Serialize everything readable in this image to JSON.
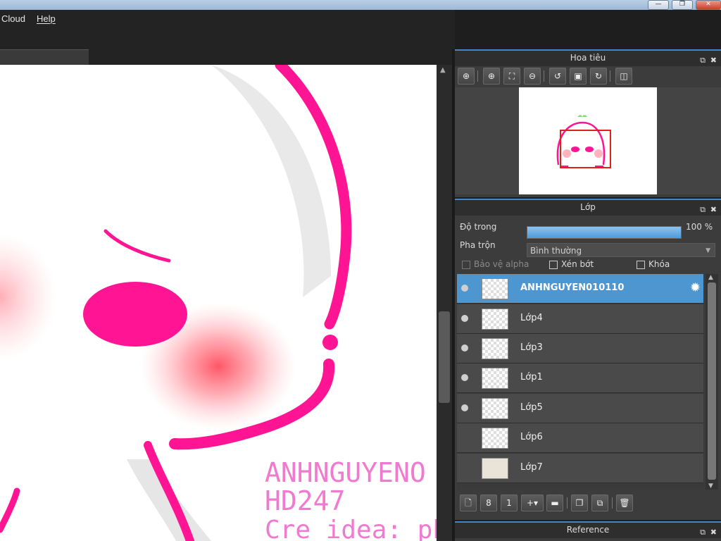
{
  "menu": {
    "items": [
      {
        "label": "Cloud",
        "accel": "o"
      },
      {
        "label": "Help",
        "accel": "H"
      }
    ]
  },
  "window_controls": {
    "minimize": "—",
    "restore": "❐",
    "close": "✕"
  },
  "canvas": {
    "watermark_lines": [
      "ANHNGUYENO",
      "HD247",
      "Cre idea: phuc"
    ],
    "colors": {
      "line": "#ff1493",
      "blush": "#ff5a6e",
      "shadow": "#e8e8e8",
      "watermark": "#f07ad0"
    }
  },
  "navigator": {
    "title": "Hoa tiêu",
    "tools": [
      "zoom-in-icon",
      "zoom-in-2-icon",
      "fit-icon",
      "zoom-out-icon",
      "rotate-left-icon",
      "actual-size-icon",
      "rotate-right-icon",
      "flip-icon"
    ]
  },
  "layers": {
    "title": "Lớp",
    "opacity_label": "Độ trong",
    "opacity_value": "100 %",
    "opacity_fraction": 1.0,
    "blend_label": "Pha trộn",
    "blend_value": "Bình thường",
    "protect_alpha_label": "Bảo vệ alpha",
    "clipping_label": "Xén bớt",
    "lock_label": "Khóa",
    "items": [
      {
        "name": "ANHNGUYEN010110",
        "visible": true,
        "selected": true
      },
      {
        "name": "Lớp4",
        "visible": true,
        "selected": false
      },
      {
        "name": "Lớp3",
        "visible": true,
        "selected": false
      },
      {
        "name": "Lớp1",
        "visible": true,
        "selected": false
      },
      {
        "name": "Lớp5",
        "visible": true,
        "selected": false
      },
      {
        "name": "Lớp6",
        "visible": false,
        "selected": false
      },
      {
        "name": "Lớp7",
        "visible": false,
        "selected": false
      }
    ]
  },
  "reference": {
    "title": "Reference"
  }
}
